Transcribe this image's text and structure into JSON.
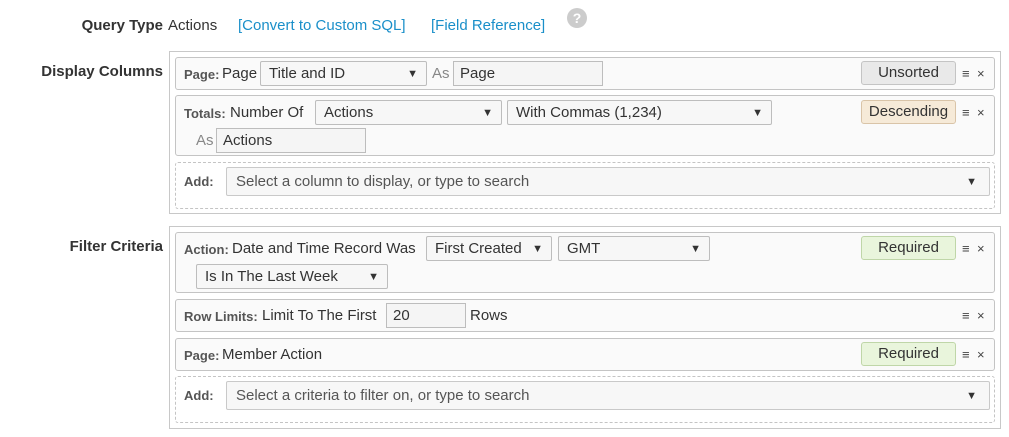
{
  "query_type": {
    "label": "Query Type",
    "value": "Actions",
    "convert_link": "[Convert to Custom SQL]",
    "field_reference_link": "[Field Reference]",
    "help_icon": "?"
  },
  "display_columns": {
    "label": "Display Columns",
    "rows": [
      {
        "type_label": "Page:",
        "text": "Page",
        "select": "Title and ID",
        "as_label": "As",
        "as_value": "Page",
        "sort": "Unsorted"
      },
      {
        "type_label": "Totals:",
        "text": "Number Of",
        "select1": "Actions",
        "select2": "With Commas (1,234)",
        "as_label": "As",
        "as_value": "Actions",
        "sort": "Descending"
      }
    ],
    "add_label": "Add:",
    "add_placeholder": "Select a column to display, or type to search"
  },
  "filter_criteria": {
    "label": "Filter Criteria",
    "rows": [
      {
        "type_label": "Action:",
        "text": "Date and Time Record Was",
        "select1": "First Created",
        "select2": "GMT",
        "select3": "Is In The Last Week",
        "status": "Required"
      },
      {
        "type_label": "Row Limits:",
        "text": "Limit To The First",
        "input": "20",
        "suffix": "Rows"
      },
      {
        "type_label": "Page:",
        "text": "Member Action",
        "status": "Required"
      }
    ],
    "add_label": "Add:",
    "add_placeholder": "Select a criteria to filter on, or type to search"
  },
  "icons": {
    "menu": "≡",
    "close": "×",
    "caret": "▼"
  }
}
